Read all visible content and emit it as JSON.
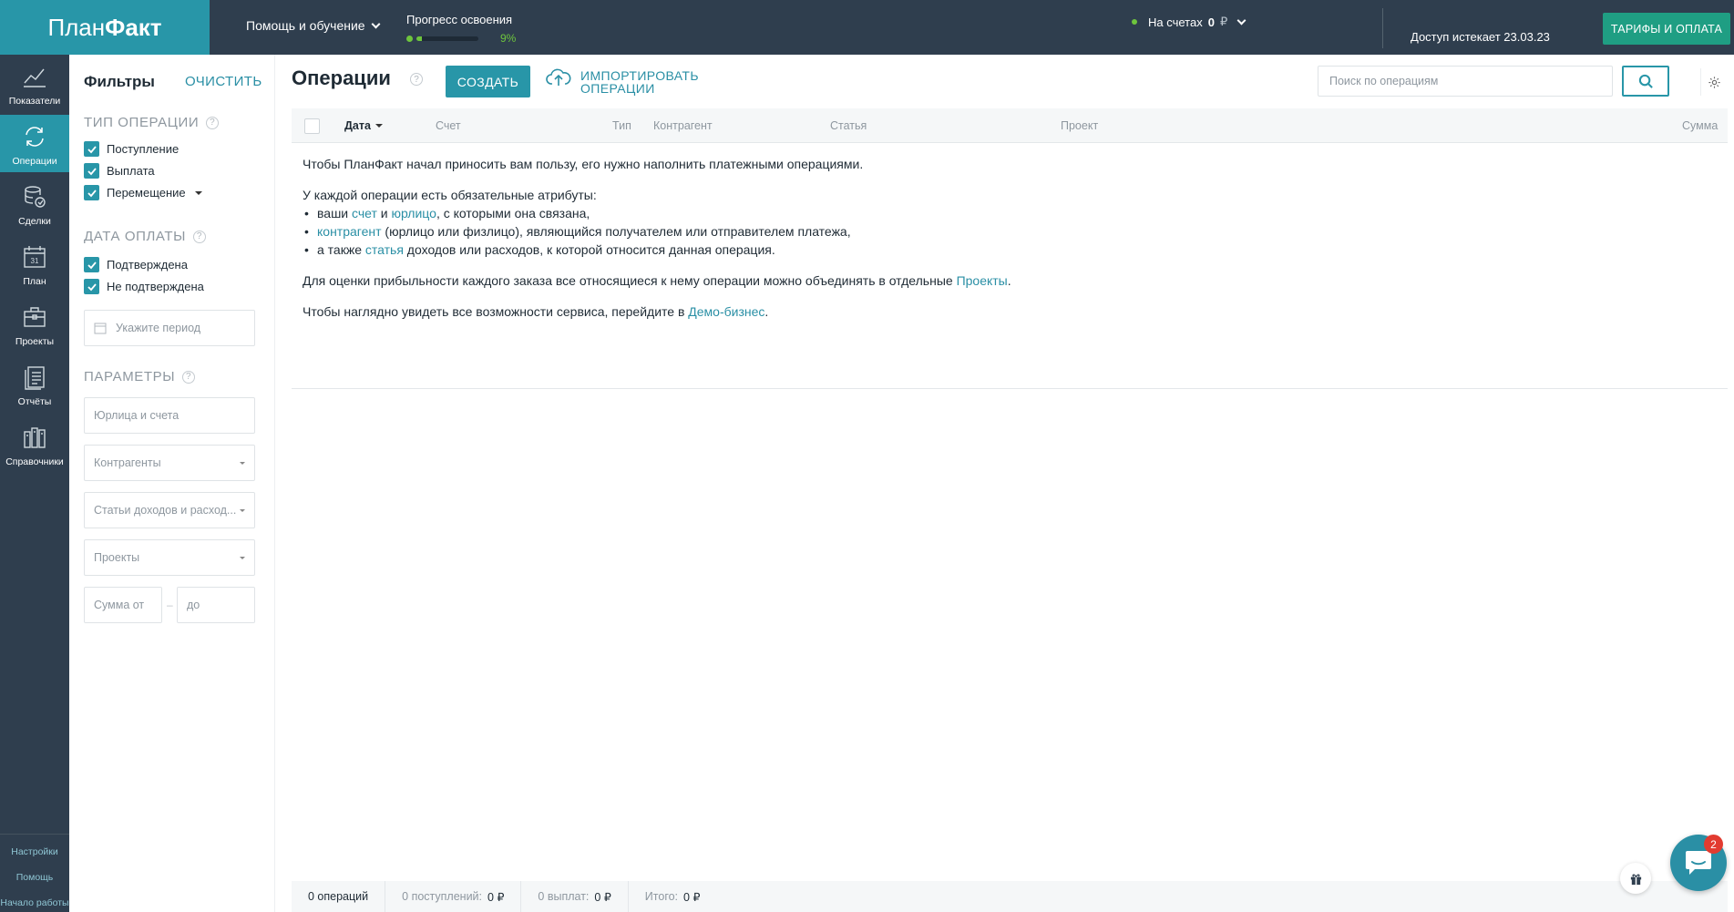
{
  "topbar": {
    "logo_pre": "План",
    "logo_bold": "Факт",
    "help_menu": "Помощь и обучение",
    "progress_label": "Прогресс освоения",
    "progress_value": 0.09,
    "progress_text": "9%",
    "balance_label": "На счетах",
    "balance_amount": "0",
    "balance_currency": "₽",
    "access_text": "Доступ истекает 23.03.23",
    "tariffs_button": "ТАРИФЫ И ОПЛАТА"
  },
  "nav": {
    "items": [
      {
        "label": "Показатели",
        "icon": "chart-icon"
      },
      {
        "label": "Операции",
        "icon": "refresh-icon"
      },
      {
        "label": "Сделки",
        "icon": "coins-icon"
      },
      {
        "label": "План",
        "icon": "calendar-icon"
      },
      {
        "label": "Проекты",
        "icon": "briefcase-icon"
      },
      {
        "label": "Отчёты",
        "icon": "report-icon"
      },
      {
        "label": "Справочники",
        "icon": "books-icon"
      }
    ],
    "calendar_day": "31",
    "bottom": [
      "Настройки",
      "Помощь",
      "Начало работы"
    ],
    "active_index": 1
  },
  "filters": {
    "title": "Фильтры",
    "clear": "ОЧИСТИТЬ",
    "type_section": "ТИП ОПЕРАЦИИ",
    "types": [
      "Поступление",
      "Выплата",
      "Перемещение"
    ],
    "date_section": "ДАТА ОПЛАТЫ",
    "dates": [
      "Подтверждена",
      "Не подтверждена"
    ],
    "period_placeholder": "Укажите период",
    "params_section": "ПАРАМЕТРЫ",
    "legal_placeholder": "Юрлица и счета",
    "contractors_placeholder": "Контрагенты",
    "articles_placeholder": "Статьи доходов и расход...",
    "projects_placeholder": "Проекты",
    "sum_from": "Сумма от",
    "sum_dash": "–",
    "sum_to": "до",
    "help_glyph": "?"
  },
  "main": {
    "title": "Операции",
    "create_button": "СОЗДАТЬ",
    "import_line1": "ИМПОРТИРОВАТЬ",
    "import_line2": "ОПЕРАЦИИ",
    "search_placeholder": "Поиск по операциям",
    "columns": {
      "date": "Дата",
      "account": "Счет",
      "type": "Тип",
      "contractor": "Контрагент",
      "article": "Статья",
      "project": "Проект",
      "sum": "Сумма"
    },
    "info": {
      "p1": "Чтобы ПланФакт начал приносить вам пользу, его нужно наполнить платежными операциями.",
      "p2": "У каждой операции есть обязательные атрибуты:",
      "li1_a": "ваши ",
      "li1_link1": "счет",
      "li1_b": " и ",
      "li1_link2": "юрлицо",
      "li1_c": ", с которыми она связана,",
      "li2_link": "контрагент",
      "li2_b": " (юрлицо или физлицо), являющийся получателем или отправителем платежа,",
      "li3_a": "а также ",
      "li3_link": "статья",
      "li3_b": " доходов или расходов, к которой относится данная операция.",
      "p3_a": "Для оценки прибыльности каждого заказа все относящиеся к нему операции можно объединять в отдельные ",
      "p3_link": "Проекты",
      "p3_b": ".",
      "p4_a": "Чтобы наглядно увидеть все возможности сервиса, перейдите в ",
      "p4_link": "Демо-бизнес",
      "p4_b": "."
    }
  },
  "footer": {
    "ops_count": "0 операций",
    "income_label": "0 поступлений:",
    "income_value": "0 ₽",
    "payout_label": "0 выплат:",
    "payout_value": "0 ₽",
    "total_label": "Итого:",
    "total_value": "0 ₽"
  },
  "chat": {
    "badge": "2"
  },
  "colors": {
    "brand": "#2896a8",
    "topbar": "#2f3e4e",
    "tariffs": "#1f9e83",
    "progress": "#6ec53d",
    "badge": "#e23b30"
  }
}
